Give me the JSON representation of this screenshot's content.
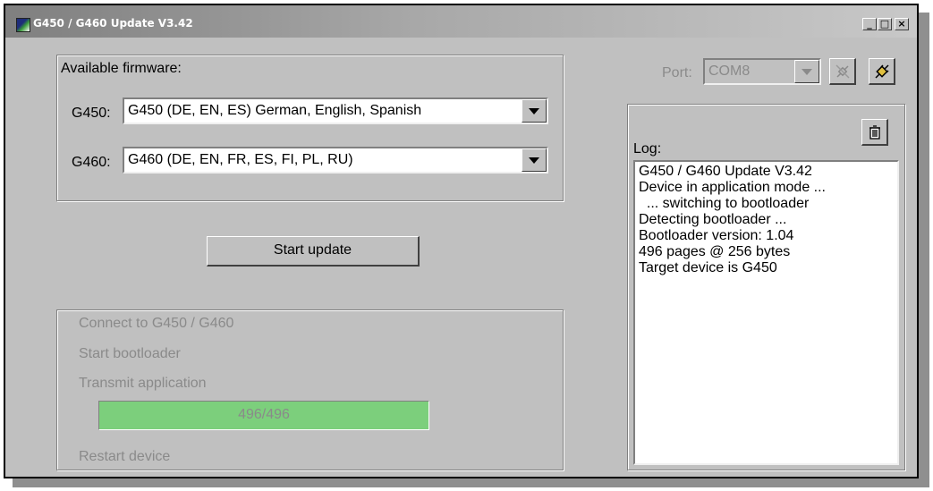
{
  "window": {
    "title": "G450 / G460 Update V3.42",
    "minimize_label": "_",
    "maximize_label": "□",
    "close_label": "×"
  },
  "firmware": {
    "group_label": "Available firmware:",
    "g450_label": "G450:",
    "g450_value": "G450 (DE, EN, ES)   German, English, Spanish",
    "g460_label": "G460:",
    "g460_value": "G460 (DE, EN, FR, ES, FI, PL, RU)"
  },
  "actions": {
    "start_update_label": "Start update"
  },
  "progress": {
    "steps": [
      "Connect to G450 / G460",
      "Start bootloader",
      "Transmit application",
      "Restart device"
    ],
    "value_text": "496/496",
    "fraction": 1.0,
    "fill_color": "#7ccf7c"
  },
  "port": {
    "label": "Port:",
    "value": "COM8",
    "disconnect_icon": "plug-disconnected-icon",
    "connect_icon": "plug-connect-icon"
  },
  "log": {
    "label": "Log:",
    "clear_icon": "trash-icon",
    "lines": [
      "G450 / G460 Update V3.42",
      "Device in application mode ...",
      "  ... switching to bootloader",
      "Detecting bootloader ...",
      "Bootloader version: 1.04",
      "496 pages @ 256 bytes",
      "Target device is G450"
    ]
  }
}
